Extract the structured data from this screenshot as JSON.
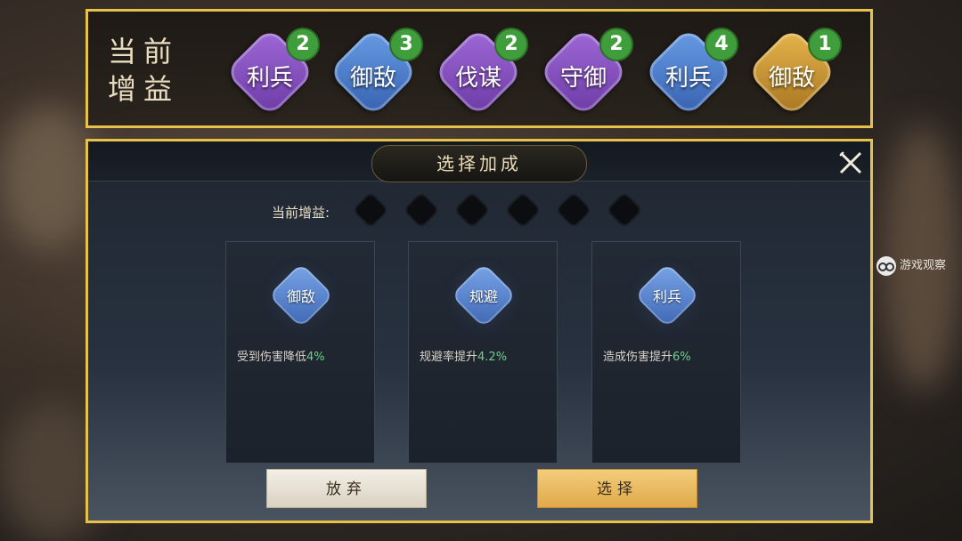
{
  "top_bar": {
    "title": "当前增益",
    "buffs": [
      {
        "label": "利兵",
        "count": "2",
        "color": "#8a55c4"
      },
      {
        "label": "御敌",
        "count": "3",
        "color": "#4d7fd0"
      },
      {
        "label": "伐谋",
        "count": "2",
        "color": "#8a55c4"
      },
      {
        "label": "守御",
        "count": "2",
        "color": "#8a55c4"
      },
      {
        "label": "利兵",
        "count": "4",
        "color": "#4d7fd0"
      },
      {
        "label": "御敌",
        "count": "1",
        "color": "#d19a36"
      }
    ]
  },
  "dialog": {
    "title": "选择加成",
    "current_buffs_label": "当前增益:",
    "cards": [
      {
        "gem_label": "御敌",
        "desc_text": "受到伤害降低",
        "desc_value": "4%"
      },
      {
        "gem_label": "规避",
        "desc_text": "规避率提升",
        "desc_value": "4.2%"
      },
      {
        "gem_label": "利兵",
        "desc_text": "造成伤害提升",
        "desc_value": "6%"
      }
    ],
    "abandon_label": "放弃",
    "select_label": "选择"
  },
  "watermark": "游戏观察",
  "colors": {
    "frame_gold": "#e7c24a",
    "count_green": "#3f9d3b",
    "value_green": "#6fd08a"
  }
}
